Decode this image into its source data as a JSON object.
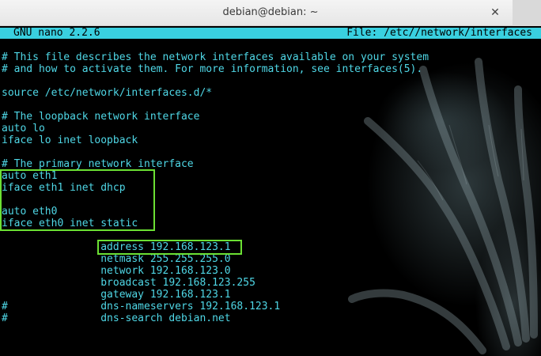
{
  "window": {
    "title": "debian@debian: ~",
    "close_glyph": "✕"
  },
  "nano": {
    "version": "GNU nano 2.2.6",
    "file": "File: /etc//network/interfaces"
  },
  "lines": [
    "# This file describes the network interfaces available on your system",
    "# and how to activate them. For more information, see interfaces(5).",
    "source /etc/network/interfaces.d/*",
    "# The loopback network interface",
    "auto lo",
    "iface lo inet loopback",
    "# The primary network interface",
    "auto eth1",
    "iface eth1 inet dhcp",
    "auto eth0",
    "iface eth0 inet static",
    "                address 192.168.123.1",
    "                netmask 255.255.255.0",
    "                network 192.168.123.0",
    "                broadcast 192.168.123.255",
    "                gateway 192.168.123.1",
    "#               dns-nameservers 192.168.123.1",
    "#               dns-search debian.net"
  ],
  "colors": {
    "text": "#4fd7e6",
    "header_bg": "#39d0e0",
    "highlight_box": "#6be033"
  }
}
